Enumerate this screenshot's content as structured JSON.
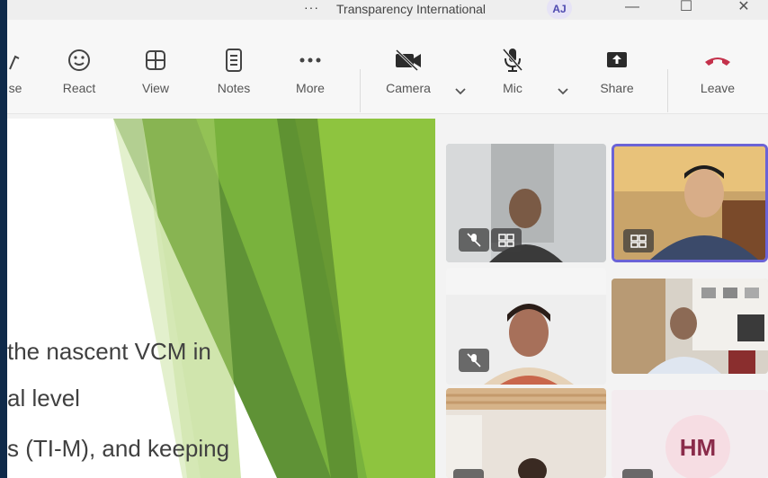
{
  "window": {
    "title_dots": "···",
    "title": "Transparency International",
    "avatar_initials": "AJ",
    "controls": {
      "minimize": "—",
      "maximize": "☐",
      "close": "✕"
    }
  },
  "toolbar": {
    "raise_label": "se",
    "react_label": "React",
    "view_label": "View",
    "notes_label": "Notes",
    "more_label": "More",
    "camera_label": "Camera",
    "mic_label": "Mic",
    "share_label": "Share",
    "leave_label": "Leave",
    "leave_color": "#c4314b"
  },
  "slide": {
    "line1": "the nascent VCM in",
    "line2": "al level",
    "line3": "s (TI-M), and keeping",
    "accent_colors": [
      "#6a9a3a",
      "#8cbf3f",
      "#4f7f2f"
    ]
  },
  "gallery": {
    "hm_initials": "HM",
    "active_speaker_color": "#6b63d6"
  }
}
